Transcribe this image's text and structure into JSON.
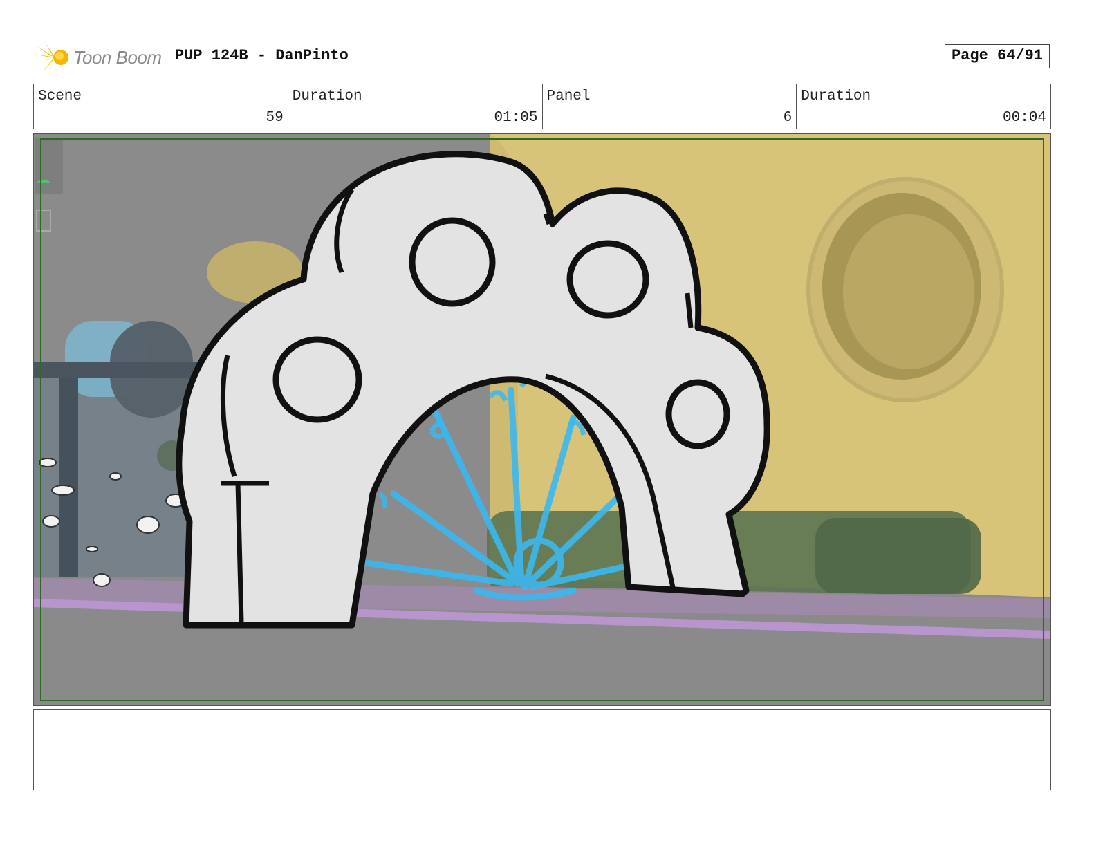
{
  "header": {
    "logo_text": "Toon Boom",
    "project_title": "PUP 124B - DanPinto",
    "page_label": "Page 64/91"
  },
  "info": {
    "scene_label": "Scene",
    "scene_value": "59",
    "scene_duration_label": "Duration",
    "scene_duration_value": "01:05",
    "panel_label": "Panel",
    "panel_value": "6",
    "panel_duration_label": "Duration",
    "panel_duration_value": "00:04"
  },
  "notes": {
    "text": ""
  },
  "colors": {
    "safe_frame": "#2d6b22",
    "arch_fill": "#e4e4e4",
    "sketch_blue": "#3bb8f0",
    "background_yellow": "#d6c277",
    "floor_purple": "#b08cc4"
  }
}
